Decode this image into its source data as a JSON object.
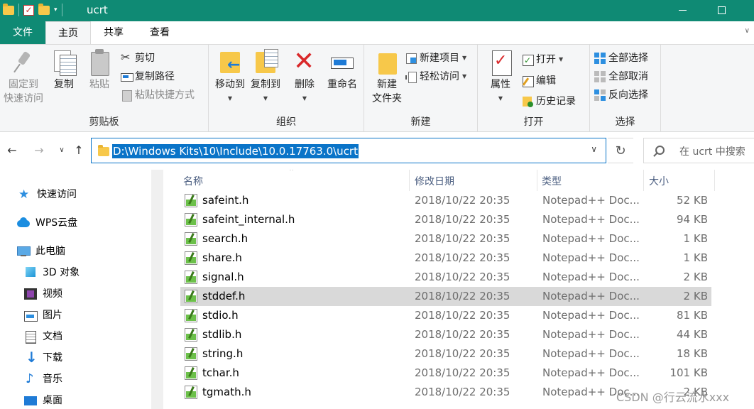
{
  "titlebar": {
    "title": "ucrt",
    "check_glyph": "✓",
    "dropdown_glyph": "▾"
  },
  "tabs": {
    "file": "文件",
    "home": "主页",
    "share": "共享",
    "view": "查看"
  },
  "ribbon": {
    "clipboard": {
      "label": "剪贴板",
      "pin": "固定到\n快速访问",
      "pin_line1": "固定到",
      "pin_line2": "快速访问",
      "copy": "复制",
      "paste": "粘贴",
      "cut": "剪切",
      "copy_path": "复制路径",
      "paste_shortcut": "粘贴快捷方式"
    },
    "organize": {
      "label": "组织",
      "move_to": "移动到",
      "copy_to": "复制到",
      "delete": "删除",
      "rename": "重命名"
    },
    "new": {
      "label": "新建",
      "new_folder_line1": "新建",
      "new_folder_line2": "文件夹",
      "new_item": "新建项目",
      "easy_access": "轻松访问"
    },
    "open": {
      "label": "打开",
      "properties": "属性",
      "open": "打开",
      "edit": "编辑",
      "history": "历史记录"
    },
    "select": {
      "label": "选择",
      "select_all": "全部选择",
      "select_none": "全部取消",
      "invert": "反向选择"
    }
  },
  "address": {
    "path": "D:\\Windows Kits\\10\\Include\\10.0.17763.0\\ucrt",
    "search_placeholder": "在 ucrt 中搜索",
    "back": "←",
    "forward": "→",
    "recent": "∨",
    "up": "↑",
    "refresh": "↻",
    "dropdown": "∨"
  },
  "navpane": {
    "items": [
      {
        "label": "快速访问",
        "icon": "star-icon"
      },
      {
        "label": "WPS云盘",
        "icon": "cloud-icon"
      },
      {
        "label": "此电脑",
        "icon": "computer-icon"
      },
      {
        "label": "3D 对象",
        "icon": "cube-icon"
      },
      {
        "label": "视频",
        "icon": "video-icon"
      },
      {
        "label": "图片",
        "icon": "picture-icon"
      },
      {
        "label": "文档",
        "icon": "document-icon"
      },
      {
        "label": "下载",
        "icon": "download-icon"
      },
      {
        "label": "音乐",
        "icon": "music-icon"
      },
      {
        "label": "桌面",
        "icon": "desktop-icon"
      }
    ]
  },
  "filelist": {
    "columns": {
      "name": "名称",
      "date": "修改日期",
      "type": "类型",
      "size": "大小"
    },
    "rows": [
      {
        "name": "safeint.h",
        "date": "2018/10/22 20:35",
        "type": "Notepad++ Doc...",
        "size": "52 KB"
      },
      {
        "name": "safeint_internal.h",
        "date": "2018/10/22 20:35",
        "type": "Notepad++ Doc...",
        "size": "94 KB"
      },
      {
        "name": "search.h",
        "date": "2018/10/22 20:35",
        "type": "Notepad++ Doc...",
        "size": "1 KB"
      },
      {
        "name": "share.h",
        "date": "2018/10/22 20:35",
        "type": "Notepad++ Doc...",
        "size": "1 KB"
      },
      {
        "name": "signal.h",
        "date": "2018/10/22 20:35",
        "type": "Notepad++ Doc...",
        "size": "2 KB"
      },
      {
        "name": "stddef.h",
        "date": "2018/10/22 20:35",
        "type": "Notepad++ Doc...",
        "size": "2 KB",
        "selected": true
      },
      {
        "name": "stdio.h",
        "date": "2018/10/22 20:35",
        "type": "Notepad++ Doc...",
        "size": "81 KB"
      },
      {
        "name": "stdlib.h",
        "date": "2018/10/22 20:35",
        "type": "Notepad++ Doc...",
        "size": "44 KB"
      },
      {
        "name": "string.h",
        "date": "2018/10/22 20:35",
        "type": "Notepad++ Doc...",
        "size": "18 KB"
      },
      {
        "name": "tchar.h",
        "date": "2018/10/22 20:35",
        "type": "Notepad++ Doc...",
        "size": "101 KB"
      },
      {
        "name": "tgmath.h",
        "date": "2018/10/22 20:35",
        "type": "Notepad++ Doc...",
        "size": "2 KB"
      }
    ]
  },
  "watermark": "CSDN @行云流水xxx",
  "colors": {
    "titlebar": "#0f8a74",
    "selection": "#0a74c8",
    "row_selected": "#d9d9d9"
  }
}
